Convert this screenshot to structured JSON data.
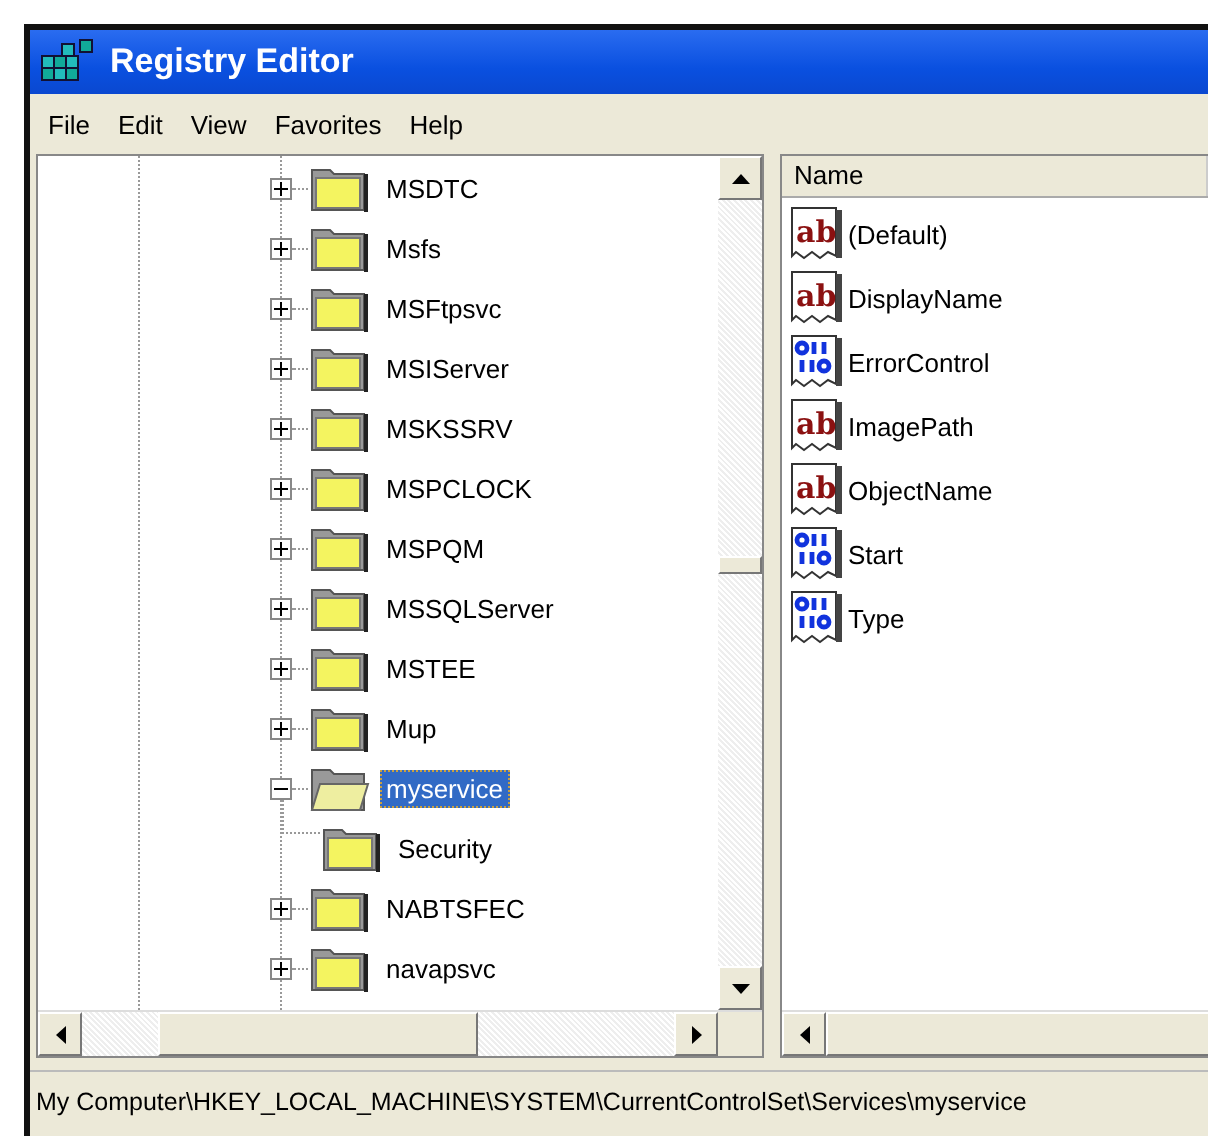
{
  "window": {
    "title": "Registry Editor"
  },
  "menu": [
    "File",
    "Edit",
    "View",
    "Favorites",
    "Help"
  ],
  "tree": [
    {
      "label": "MSDTC",
      "expanded": false,
      "selected": false
    },
    {
      "label": "Msfs",
      "expanded": false,
      "selected": false
    },
    {
      "label": "MSFtpsvc",
      "expanded": false,
      "selected": false
    },
    {
      "label": "MSIServer",
      "expanded": false,
      "selected": false
    },
    {
      "label": "MSKSSRV",
      "expanded": false,
      "selected": false
    },
    {
      "label": "MSPCLOCK",
      "expanded": false,
      "selected": false
    },
    {
      "label": "MSPQM",
      "expanded": false,
      "selected": false
    },
    {
      "label": "MSSQLServer",
      "expanded": false,
      "selected": false
    },
    {
      "label": "MSTEE",
      "expanded": false,
      "selected": false
    },
    {
      "label": "Mup",
      "expanded": false,
      "selected": false
    },
    {
      "label": "myservice",
      "expanded": true,
      "selected": true,
      "children": [
        {
          "label": "Security",
          "selected": false
        }
      ]
    },
    {
      "label": "NABTSFEC",
      "expanded": false,
      "selected": false
    },
    {
      "label": "navapsvc",
      "expanded": false,
      "selected": false
    }
  ],
  "values_list": {
    "columns": [
      "Name"
    ],
    "rows": [
      {
        "name": "(Default)",
        "kind": "string",
        "icon_text": "ab"
      },
      {
        "name": "DisplayName",
        "kind": "string",
        "icon_text": "ab"
      },
      {
        "name": "ErrorControl",
        "kind": "dword"
      },
      {
        "name": "ImagePath",
        "kind": "string",
        "icon_text": "ab"
      },
      {
        "name": "ObjectName",
        "kind": "string",
        "icon_text": "ab"
      },
      {
        "name": "Start",
        "kind": "dword"
      },
      {
        "name": "Type",
        "kind": "dword"
      }
    ]
  },
  "status_bar": "My Computer\\HKEY_LOCAL_MACHINE\\SYSTEM\\CurrentControlSet\\Services\\myservice"
}
